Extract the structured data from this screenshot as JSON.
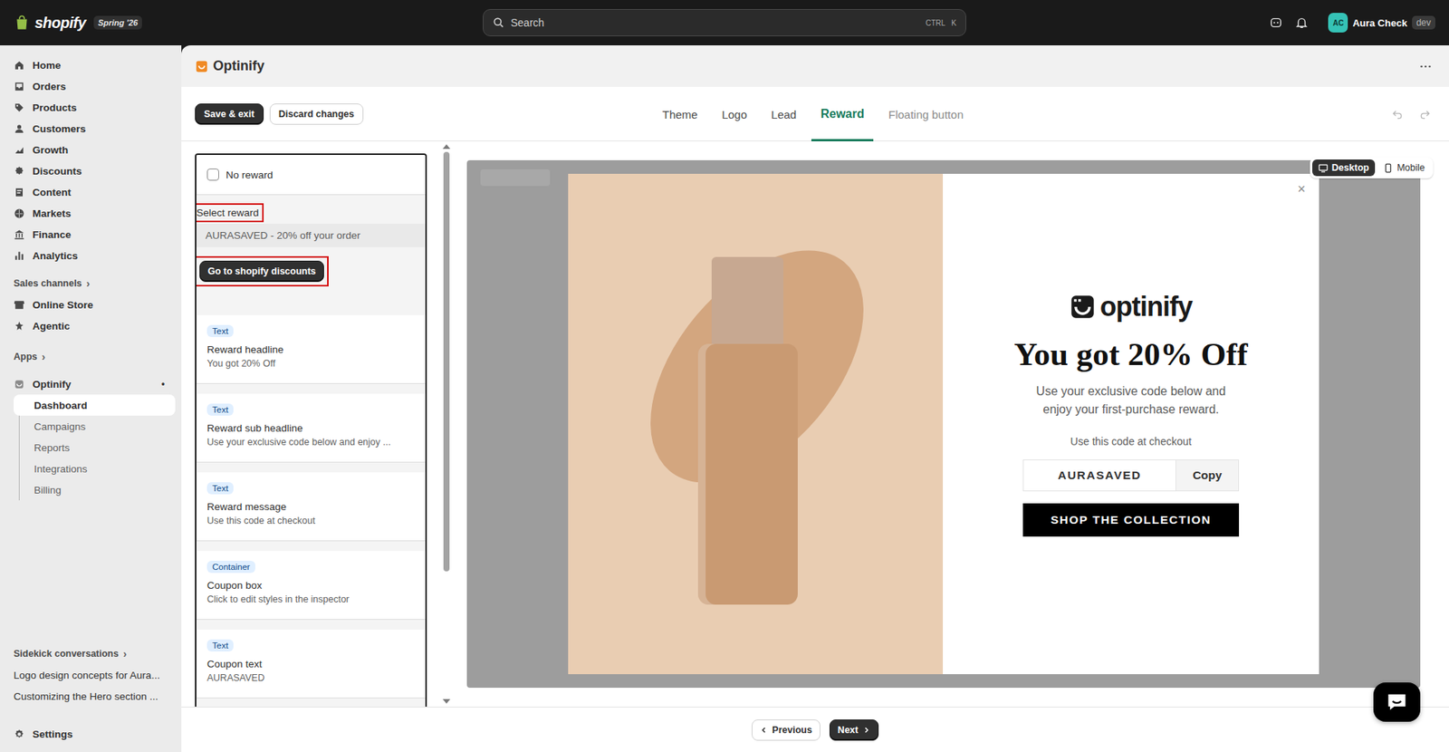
{
  "topbar": {
    "brand": "shopify",
    "badge": "Spring '26",
    "search": {
      "placeholder": "Search",
      "shortcut": [
        "CTRL",
        "K"
      ]
    },
    "user": {
      "initials": "AC",
      "name": "Aura Check",
      "tag": "dev"
    }
  },
  "sidebar": {
    "nav": [
      {
        "label": "Home",
        "selected": false
      },
      {
        "label": "Orders",
        "selected": false
      },
      {
        "label": "Products",
        "selected": false
      },
      {
        "label": "Customers",
        "selected": false
      },
      {
        "label": "Growth",
        "selected": false
      },
      {
        "label": "Discounts",
        "selected": false
      },
      {
        "label": "Content",
        "selected": false
      },
      {
        "label": "Markets",
        "selected": false
      },
      {
        "label": "Finance",
        "selected": false
      },
      {
        "label": "Analytics",
        "selected": false
      }
    ],
    "sales_channels": {
      "label": "Sales channels",
      "chevron": "›",
      "items": [
        {
          "label": "Online Store",
          "selected": false
        },
        {
          "label": "Agentic",
          "selected": false
        }
      ]
    },
    "apps": {
      "label": "Apps",
      "chevron": "›",
      "app": {
        "label": "Optinify",
        "dot": "•"
      },
      "items": [
        {
          "label": "Dashboard",
          "selected": true
        },
        {
          "label": "Campaigns",
          "selected": false
        },
        {
          "label": "Reports",
          "selected": false
        },
        {
          "label": "Integrations",
          "selected": false
        },
        {
          "label": "Billing",
          "selected": false
        }
      ]
    },
    "sidekick": {
      "label": "Sidekick conversations",
      "chevron": "›",
      "items": [
        "Logo design concepts for Aura...",
        "Customizing the Hero section ..."
      ]
    },
    "settings": "Settings"
  },
  "page": {
    "title": "Optinify"
  },
  "toolbar": {
    "save": "Save & exit",
    "discard": "Discard changes",
    "tabs": [
      {
        "label": "Theme",
        "selected": false,
        "disabled": false
      },
      {
        "label": "Logo",
        "selected": false,
        "disabled": false
      },
      {
        "label": "Lead",
        "selected": false,
        "disabled": false
      },
      {
        "label": "Reward",
        "selected": true,
        "disabled": false
      },
      {
        "label": "Floating button",
        "selected": false,
        "disabled": true
      }
    ],
    "undo_enabled": false,
    "redo_enabled": false
  },
  "panel": {
    "no_reward": {
      "label": "No reward",
      "checked": false
    },
    "select_reward": {
      "label": "Select reward",
      "highlighted": true,
      "value": "AURASAVED - 20% off your order"
    },
    "discounts_button": {
      "label": "Go to shopify discounts",
      "highlighted": true
    },
    "blocks": [
      {
        "type": "Text",
        "title": "Reward headline",
        "value": "You got 20% Off"
      },
      {
        "type": "Text",
        "title": "Reward sub headline",
        "value": "Use your exclusive code below and enjoy ..."
      },
      {
        "type": "Text",
        "title": "Reward message",
        "value": "Use this code at checkout"
      },
      {
        "type": "Container",
        "title": "Coupon box",
        "value": "Click to edit styles in the inspector"
      },
      {
        "type": "Text",
        "title": "Coupon text",
        "value": "AURASAVED"
      }
    ]
  },
  "preview": {
    "devices": [
      {
        "label": "Desktop",
        "selected": true
      },
      {
        "label": "Mobile",
        "selected": false
      }
    ],
    "popup": {
      "close": "×",
      "logo": "optinify",
      "headline": "You got 20% Off",
      "subheadline": "Use your exclusive code below and enjoy your first-purchase reward.",
      "message": "Use this code at checkout",
      "code": "AURASAVED",
      "copy": "Copy",
      "cta": "SHOP THE COLLECTION"
    }
  },
  "footer": {
    "previous": "Previous",
    "next": "Next"
  }
}
